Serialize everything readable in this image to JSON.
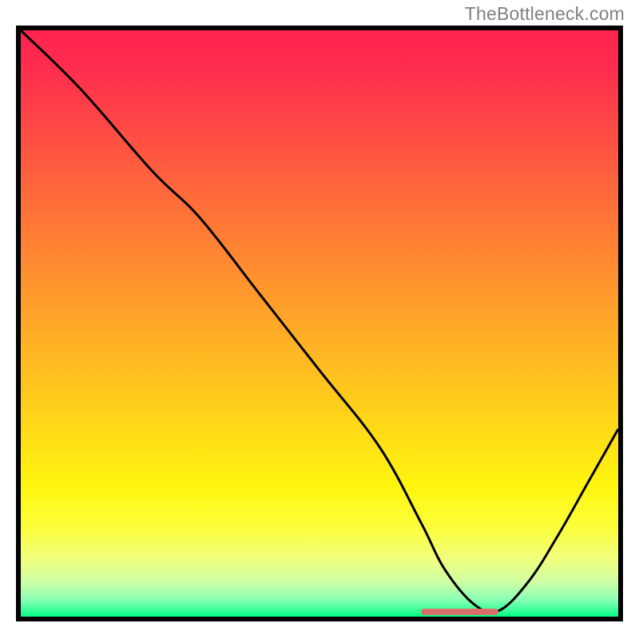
{
  "watermark": "TheBottleneck.com",
  "chart_data": {
    "type": "line",
    "title": "",
    "xlabel": "",
    "ylabel": "",
    "xlim": [
      0,
      100
    ],
    "ylim": [
      0,
      100
    ],
    "series": [
      {
        "name": "bottleneck-curve",
        "x": [
          0,
          10,
          22,
          30,
          40,
          50,
          60,
          67,
          71,
          76,
          80,
          85,
          90,
          95,
          100
        ],
        "values": [
          100,
          90,
          76,
          68,
          55,
          42,
          29,
          16,
          8,
          2,
          1,
          6,
          14,
          23,
          32
        ]
      }
    ],
    "trough_marker": {
      "x_start": 67,
      "x_end": 80,
      "y": 0.5
    },
    "background": {
      "gradient": [
        "#ff234f",
        "#ff8632",
        "#fff60f",
        "#00ff7e"
      ],
      "direction": "top-to-bottom"
    }
  }
}
